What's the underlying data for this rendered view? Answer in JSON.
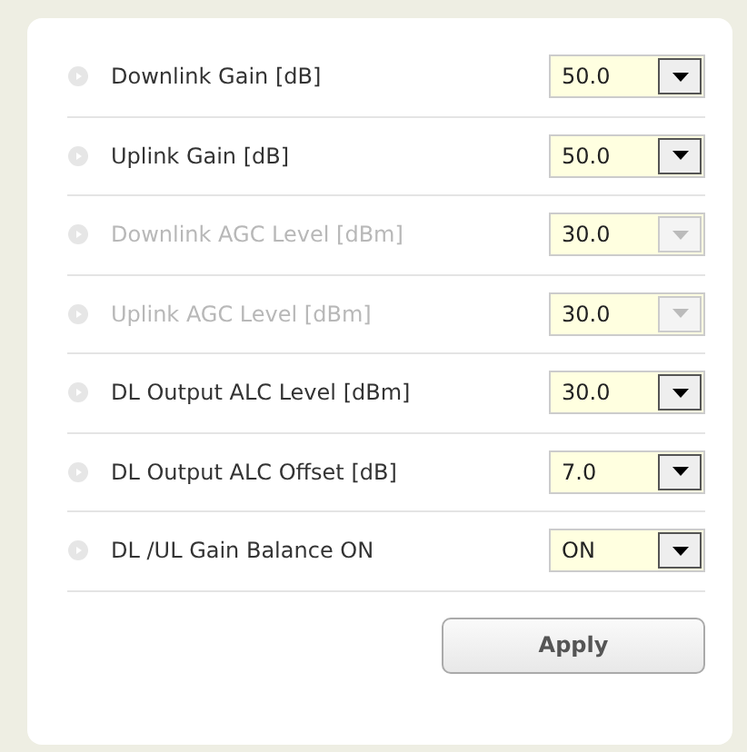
{
  "settings": [
    {
      "label": "Downlink Gain [dB]",
      "value": "50.0",
      "disabled": false
    },
    {
      "label": "Uplink Gain [dB]",
      "value": "50.0",
      "disabled": false
    },
    {
      "label": "Downlink AGC Level [dBm]",
      "value": "30.0",
      "disabled": true
    },
    {
      "label": "Uplink AGC Level [dBm]",
      "value": "30.0",
      "disabled": true
    },
    {
      "label": "DL Output ALC Level [dBm]",
      "value": "30.0",
      "disabled": false
    },
    {
      "label": "DL Output ALC Offset [dB]",
      "value": "7.0",
      "disabled": false
    },
    {
      "label": "DL /UL Gain Balance ON",
      "value": "ON",
      "disabled": false
    }
  ],
  "apply_button": "Apply"
}
